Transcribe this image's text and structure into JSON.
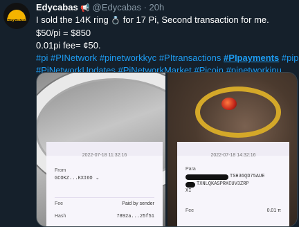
{
  "user": {
    "name": "Edycabas",
    "emoji": "📢",
    "handle": "@Edycabas",
    "time": "20h",
    "avatar_text": "Edycabas"
  },
  "tweet": {
    "line1_pre": "I sold the 14K ring",
    "line1_emoji": "💍",
    "line1_post": "for 17 Pi, Second transaction for me.",
    "line2": "$50/pi = $850",
    "line3": "0.01pi fee= ¢50.",
    "hashtags_line1": [
      "#pi",
      "#PINetwork",
      "#pinetworkkyc",
      "#PItransactions",
      "#PIpayments",
      "#pipay"
    ],
    "hashtags_line2": [
      "#PiNetworkUpdates",
      "#PiNetworkMarket",
      "#Picoin",
      "#pinetworkinu"
    ]
  },
  "receipt_left": {
    "date": "2022-07-18 11:32:16",
    "from_label": "From",
    "from_value": "GCOKZ...KXI6O",
    "fee_label": "Fee",
    "fee_value": "Paid by sender",
    "hash_label": "Hash",
    "hash_value": "7892a...25f51"
  },
  "receipt_right": {
    "date": "2022-07-18 14:32:16",
    "to_label": "Para",
    "to_line1": "TSH36QD75AUE",
    "to_line2": "TXNLQKASPRKCUV3ZRP",
    "to_line3": "XI",
    "fee_label": "Fee",
    "fee_value": "0.01 π"
  }
}
